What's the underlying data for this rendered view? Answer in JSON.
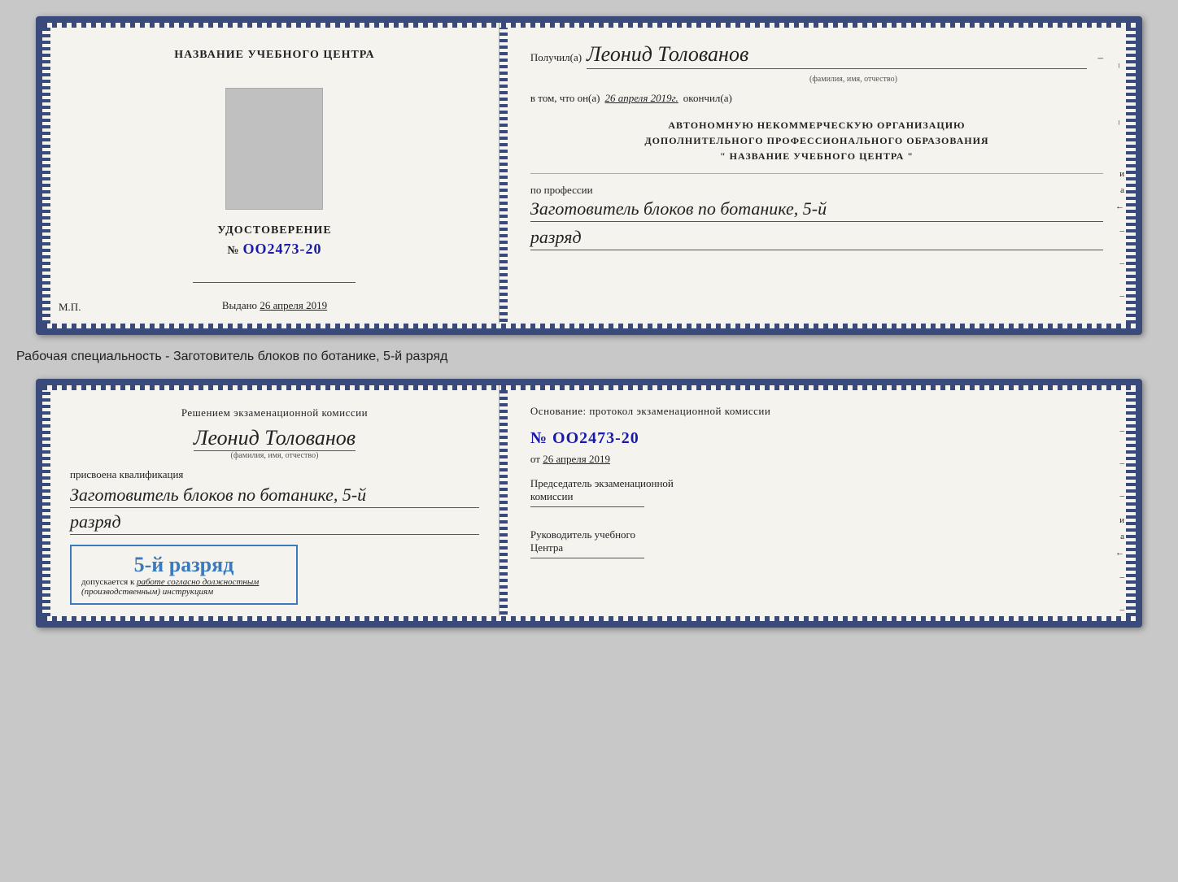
{
  "topCard": {
    "left": {
      "title": "НАЗВАНИЕ УЧЕБНОГО ЦЕНТРА",
      "udostoverenie_label": "УДОСТОВЕРЕНИЕ",
      "number_prefix": "№",
      "number": "OO2473-20",
      "vydano_label": "Выдано",
      "vydano_date": "26 апреля 2019",
      "mp_label": "М.П."
    },
    "right": {
      "poluchil_prefix": "Получил(а)",
      "recipient_name": "Леонид Толованов",
      "name_sublabel": "(фамилия, имя, отчество)",
      "dash": "–",
      "v_tom_prefix": "в том, что он(а)",
      "completion_date": "26 апреля 2019г.",
      "okончил": "окончил(а)",
      "org_line1": "АВТОНОМНУЮ НЕКОММЕРЧЕСКУЮ ОРГАНИЗАЦИЮ",
      "org_line2": "ДОПОЛНИТЕЛЬНОГО ПРОФЕССИОНАЛЬНОГО ОБРАЗОВАНИЯ",
      "org_line3": "\"   НАЗВАНИЕ УЧЕБНОГО ЦЕНТРА   \"",
      "po_professii": "по профессии",
      "profession": "Заготовитель блоков по ботанике, 5-й",
      "razryad": "разряд"
    }
  },
  "specialtyText": "Рабочая специальность - Заготовитель блоков по ботанике, 5-й разряд",
  "bottomCard": {
    "left": {
      "resheniem": "Решением экзаменационной комиссии",
      "recipient_name": "Леонид Толованов",
      "name_sublabel": "(фамилия, имя, отчество)",
      "prisvoena": "присвоена квалификация",
      "qualification": "Заготовитель блоков по ботанике, 5-й",
      "razryad": "разряд",
      "stamp_rank": "5-й разряд",
      "dopusk_prefix": "допускается к",
      "dopusk_text": "работе согласно должностным",
      "dopusk_text2": "(производственным) инструкциям"
    },
    "right": {
      "osnovanie": "Основание: протокол экзаменационной комиссии",
      "number_prefix": "№",
      "number": "OO2473-20",
      "ot_prefix": "от",
      "ot_date": "26 апреля 2019",
      "predsedatel_line1": "Председатель экзаменационной",
      "predsedatel_line2": "комиссии",
      "rukovoditel_line1": "Руководитель учебного",
      "rukovoditel_line2": "Центра"
    }
  },
  "verticalLabels": {
    "i": "и",
    "a": "а",
    "arrow": "←"
  }
}
